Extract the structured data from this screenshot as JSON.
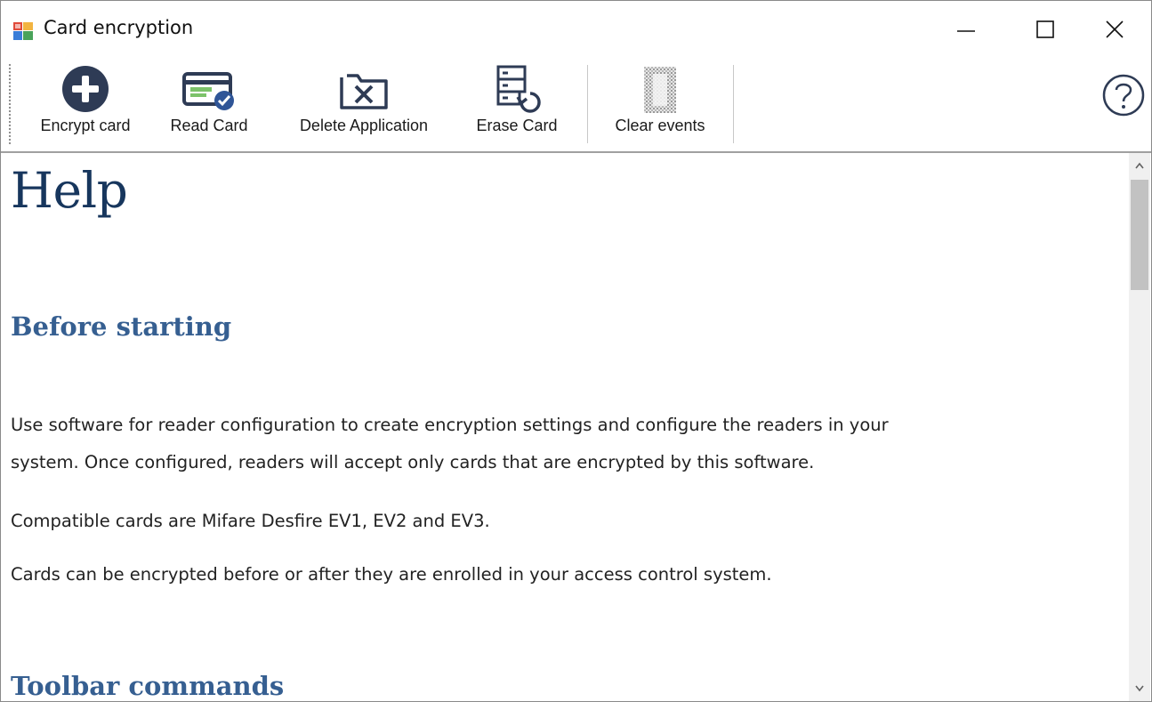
{
  "window": {
    "title": "Card encryption"
  },
  "toolbar": {
    "items": [
      {
        "label": "Encrypt card",
        "icon": "plus-circle-icon"
      },
      {
        "label": "Read Card",
        "icon": "card-check-icon"
      },
      {
        "label": "Delete Application",
        "icon": "folder-x-icon"
      },
      {
        "label": "Erase Card",
        "icon": "server-restore-icon"
      },
      {
        "label": "Clear events",
        "icon": "clear-events-icon"
      }
    ],
    "help_icon": "help-circle-icon"
  },
  "content": {
    "heading": "Help",
    "section1_title": "Before starting",
    "paragraphs": [
      "Use software for reader configuration to create encryption settings and configure the readers in your",
      "system. Once configured, readers will accept only cards that are encrypted by this software.",
      "Compatible cards are Mifare Desfire EV1, EV2 and EV3.",
      "Cards can be encrypted before or after they are enrolled in your access control system."
    ],
    "section2_title": "Toolbar commands"
  },
  "colors": {
    "heading": "#17365d",
    "section": "#365f91",
    "icon_dark": "#2e3b55"
  }
}
